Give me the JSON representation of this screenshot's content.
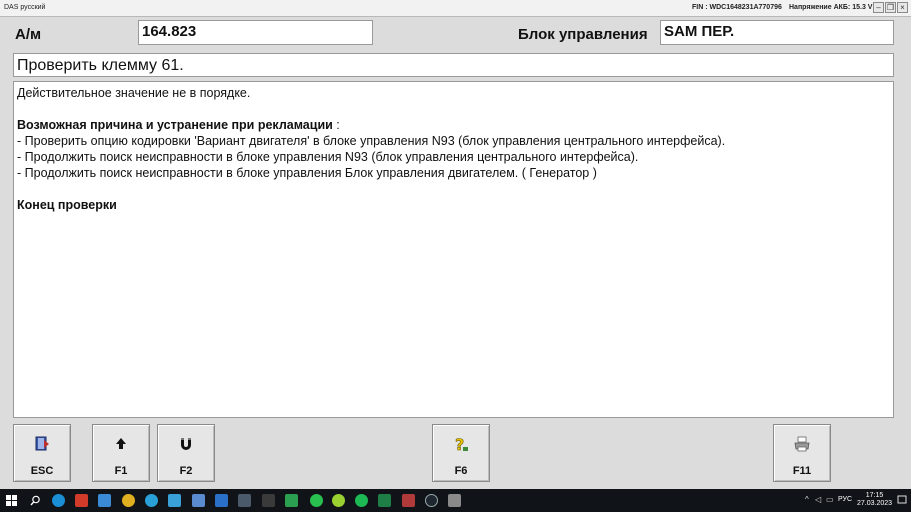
{
  "window": {
    "title": "DAS русский",
    "fin": "FIN : WDC1648231A770796",
    "voltage": "Напряжение АКБ: 15.3 V"
  },
  "header": {
    "unit_label": "А/м",
    "unit_value": "164.823",
    "control_unit_label": "Блок управления",
    "control_unit_value": "SAM ПЕР."
  },
  "test_title": "Проверить клемму 61.",
  "content": {
    "status": "Действительное значение не в порядке.",
    "cause_heading": "Возможная причина и устранение при рекламации",
    "cause_colon": " :",
    "items": [
      "- Проверить опцию кодировки 'Вариант двигателя' в блоке управления N93 (блок управления центрального интерфейса).",
      "- Продолжить поиск неисправности в блоке управления N93 (блок управления центрального интерфейса).",
      "- Продолжить поиск неисправности в блоке управления Блок управления двигателем. ( Генератор )"
    ],
    "end_label": "Конец проверки"
  },
  "fkeys": [
    {
      "label": "ESC",
      "icon": "exit-book-icon"
    },
    {
      "label": "F1",
      "icon": "arrow-up-icon"
    },
    {
      "label": "F2",
      "icon": "magnet-icon"
    },
    {
      "label": "F6",
      "icon": "help-question-icon"
    },
    {
      "label": "F11",
      "icon": "printer-icon"
    }
  ],
  "taskbar": {
    "language": "РУС",
    "time": "17:15",
    "date": "27.03.2023"
  }
}
